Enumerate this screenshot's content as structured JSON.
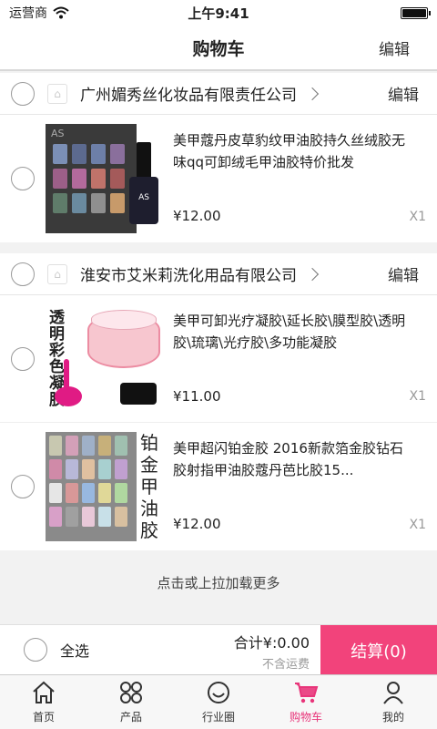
{
  "status_bar": {
    "carrier": "运营商",
    "time": "上午9:41",
    "battery_level": 1.0
  },
  "nav": {
    "title": "购物车",
    "edit_label": "编辑"
  },
  "shops": [
    {
      "name": "广州媚秀丝化妆品有限责任公司",
      "edit_label": "编辑",
      "items": [
        {
          "title": "美甲蔻丹皮草豹纹甲油胶持久丝绒胶无味qq可卸绒毛甲油胶特价批发",
          "price": "¥12.00",
          "qty": "X1",
          "image_text": "AS"
        }
      ]
    },
    {
      "name": "淮安市艾米莉洗化用品有限公司",
      "edit_label": "编辑",
      "items": [
        {
          "title": "美甲可卸光疗凝胶\\延长胶\\膜型胶\\透明胶\\琉璃\\光疗胶\\多功能凝胶",
          "price": "¥11.00",
          "qty": "X1",
          "image_text": "透明彩色凝胶"
        },
        {
          "title": "美甲超闪铂金胶 2016新款箔金胶钻石胶射指甲油胶蔻丹芭比胶15...",
          "price": "¥12.00",
          "qty": "X1",
          "image_text": "铂金甲油胶"
        }
      ]
    }
  ],
  "load_more": "点击或上拉加载更多",
  "checkout": {
    "select_all": "全选",
    "total": "合计¥:0.00",
    "shipping_note": "不含运费",
    "button_label": "结算(0)"
  },
  "tabs": [
    {
      "label": "首页",
      "icon": "home-icon"
    },
    {
      "label": "产品",
      "icon": "grid-icon"
    },
    {
      "label": "行业圈",
      "icon": "smile-icon"
    },
    {
      "label": "购物车",
      "icon": "cart-icon",
      "active": true
    },
    {
      "label": "我的",
      "icon": "user-icon"
    }
  ],
  "colors": {
    "accent": "#f2437b",
    "active_tab": "#e8357a"
  }
}
